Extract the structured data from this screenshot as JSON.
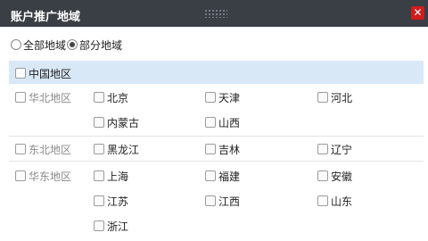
{
  "dialog": {
    "title": "账户推广地域",
    "close_icon": "close-icon"
  },
  "scope": {
    "all_label": "全部地域",
    "partial_label": "部分地域",
    "selected": "partial"
  },
  "china": {
    "label": "中国地区"
  },
  "regions": [
    {
      "label": "华北地区",
      "items": [
        "北京",
        "天津",
        "河北",
        "内蒙古",
        "山西"
      ]
    },
    {
      "label": "东北地区",
      "items": [
        "黑龙江",
        "吉林",
        "辽宁"
      ]
    },
    {
      "label": "华东地区",
      "items": [
        "上海",
        "福建",
        "安徽",
        "江苏",
        "江西",
        "山东",
        "浙江"
      ]
    }
  ]
}
